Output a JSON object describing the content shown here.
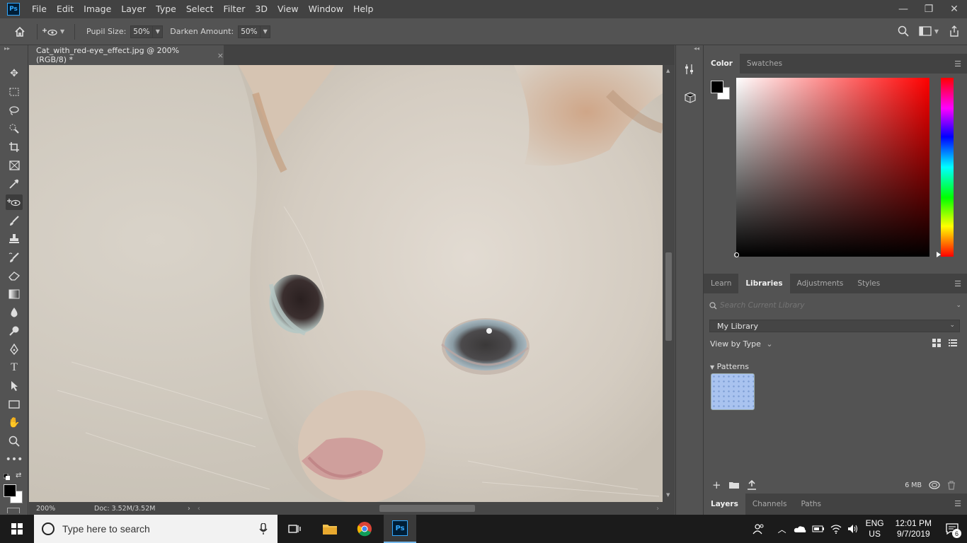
{
  "app": {
    "logo": "Ps"
  },
  "menu": [
    "File",
    "Edit",
    "Image",
    "Layer",
    "Type",
    "Select",
    "Filter",
    "3D",
    "View",
    "Window",
    "Help"
  ],
  "window_controls": {
    "minimize": "—",
    "restore": "❐",
    "close": "✕"
  },
  "options": {
    "pupil_label": "Pupil Size:",
    "pupil_value": "50%",
    "darken_label": "Darken Amount:",
    "darken_value": "50%"
  },
  "document": {
    "tab_title": "Cat_with_red-eye_effect.jpg @ 200% (RGB/8) *",
    "close": "×",
    "zoom": "200%",
    "doc_info": "Doc: 3.52M/3.52M"
  },
  "color_panel": {
    "tabs": [
      "Color",
      "Swatches"
    ],
    "foreground": "#000000",
    "background": "#ffffff"
  },
  "libraries_panel": {
    "tabs": [
      "Learn",
      "Libraries",
      "Adjustments",
      "Styles"
    ],
    "search_placeholder": "Search Current Library",
    "library": "My Library",
    "view_by": "View by Type",
    "section": "Patterns",
    "size": "6 MB"
  },
  "layers_panel": {
    "tabs": [
      "Layers",
      "Channels",
      "Paths"
    ]
  },
  "taskbar": {
    "search_placeholder": "Type here to search",
    "lang_top": "ENG",
    "lang_bottom": "US",
    "time": "12:01 PM",
    "date": "9/7/2019",
    "notifications": "6"
  }
}
